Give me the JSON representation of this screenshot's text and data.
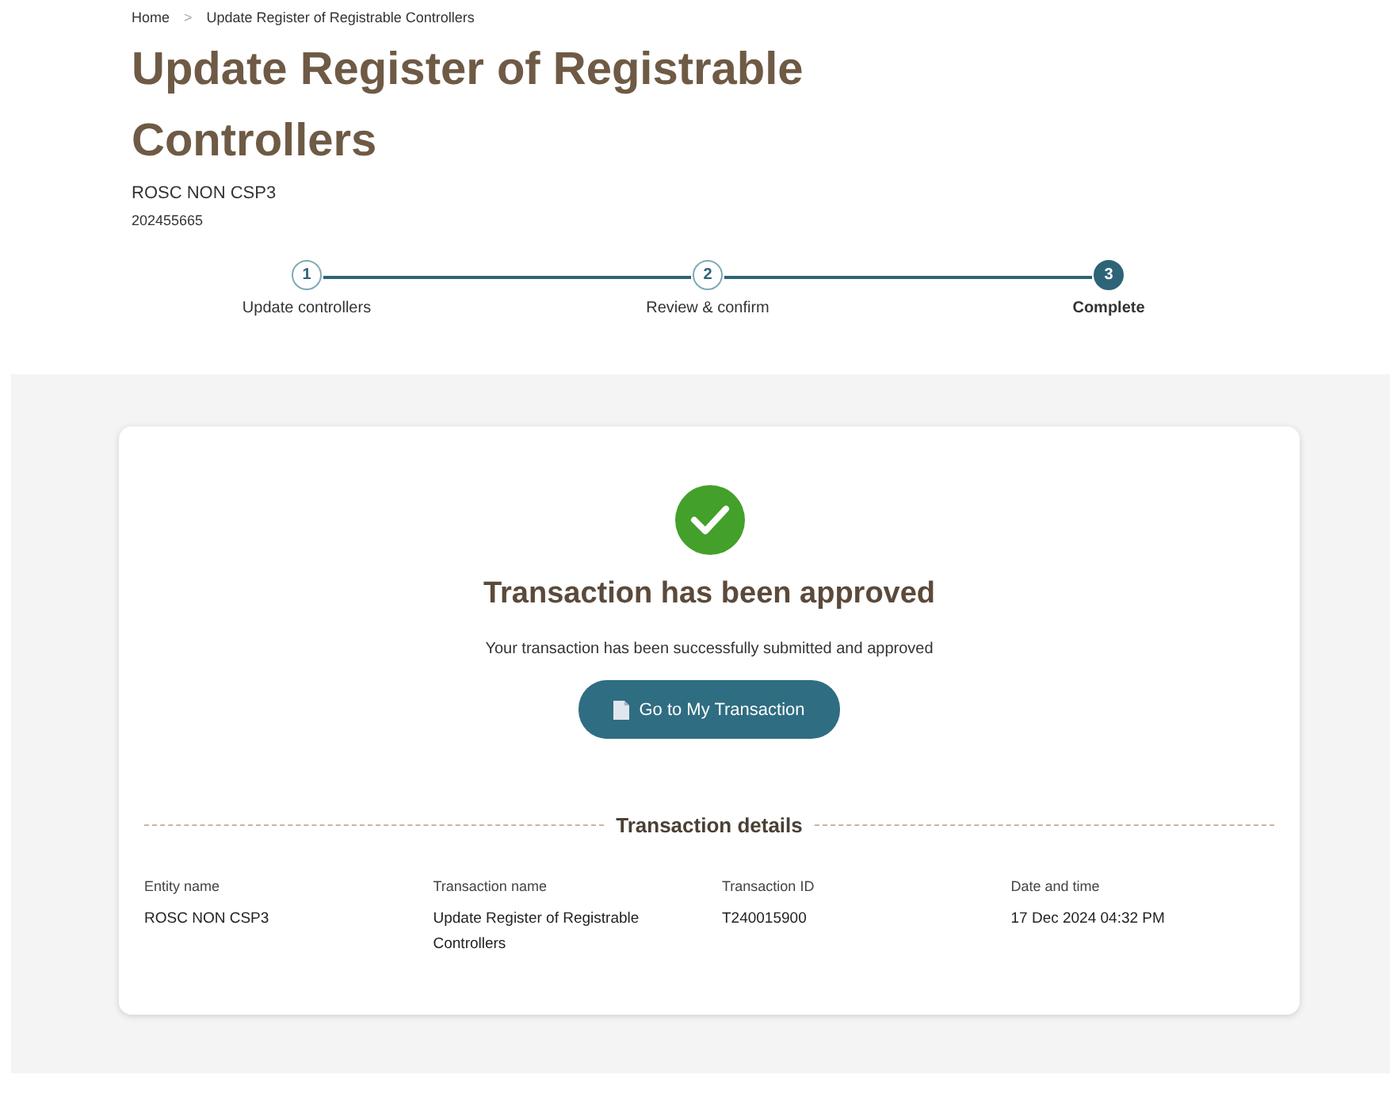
{
  "breadcrumb": [
    {
      "label": "Home"
    },
    {
      "label": "Update Register of Registrable Controllers"
    }
  ],
  "breadcrumb_separator": ">",
  "title": "Update Register of Registrable Controllers",
  "entity": "ROSC NON CSP3",
  "entity_number": "202455665",
  "steps": [
    {
      "number": "1",
      "label": "Update controllers",
      "selected": false
    },
    {
      "number": "2",
      "label": "Review & confirm",
      "selected": false
    },
    {
      "number": "3",
      "label": "Complete",
      "selected": true
    }
  ],
  "result": {
    "heading": "Transaction has been approved",
    "message": "Your transaction has been successfully submitted and approved",
    "button": "Go to My Transaction"
  },
  "details": {
    "heading": "Transaction details",
    "fields": [
      {
        "label": "Entity name",
        "value": "ROSC NON CSP3"
      },
      {
        "label": "Transaction name",
        "value": "Update Register of Registrable Controllers"
      },
      {
        "label": "Transaction ID",
        "value": "T240015900"
      },
      {
        "label": "Date and time",
        "value": "17 Dec 2024 04:32 PM"
      }
    ]
  }
}
